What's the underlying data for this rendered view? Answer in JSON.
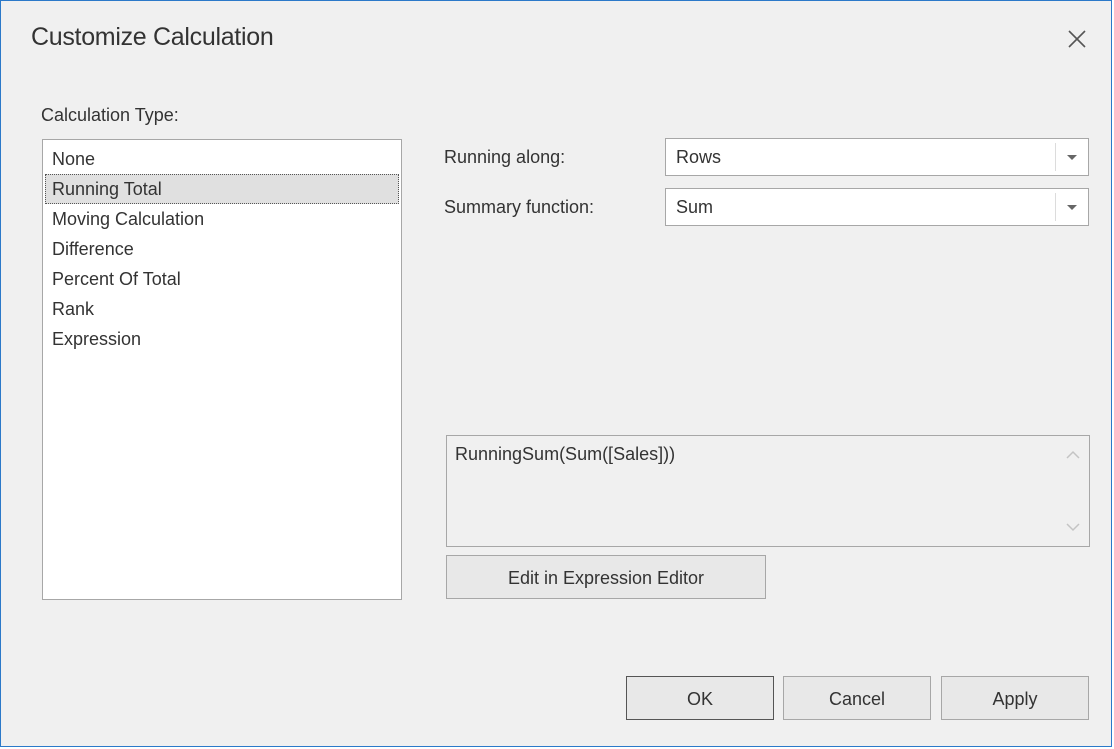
{
  "dialog": {
    "title": "Customize Calculation"
  },
  "calc_type": {
    "label": "Calculation Type:",
    "items": [
      {
        "label": "None",
        "selected": false
      },
      {
        "label": "Running Total",
        "selected": true
      },
      {
        "label": "Moving Calculation",
        "selected": false
      },
      {
        "label": "Difference",
        "selected": false
      },
      {
        "label": "Percent Of Total",
        "selected": false
      },
      {
        "label": "Rank",
        "selected": false
      },
      {
        "label": "Expression",
        "selected": false
      }
    ]
  },
  "running_along": {
    "label": "Running along:",
    "value": "Rows"
  },
  "summary_function": {
    "label": "Summary function:",
    "value": "Sum"
  },
  "expression": {
    "text": "RunningSum(Sum([Sales]))",
    "edit_button": "Edit in Expression Editor"
  },
  "buttons": {
    "ok": "OK",
    "cancel": "Cancel",
    "apply": "Apply"
  },
  "colors": {
    "window_border": "#2b79c9",
    "dialog_bg": "#f0f0f0",
    "selected_item_bg": "#e0e0e0"
  },
  "icons": {
    "close": "close-icon",
    "dropdown": "chevron-down-icon",
    "scroll_up": "scroll-up-icon",
    "scroll_down": "scroll-down-icon"
  }
}
